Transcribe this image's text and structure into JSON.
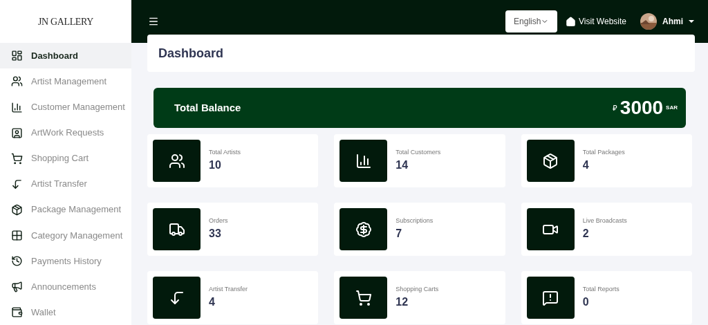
{
  "logo": "JN GALLERY",
  "sidebar": {
    "items": [
      {
        "label": "Dashboard",
        "selected": true
      },
      {
        "label": "Artist Management",
        "selected": false
      },
      {
        "label": "Customer Management",
        "selected": false
      },
      {
        "label": "ArtWork Requests",
        "selected": false
      },
      {
        "label": "Shopping Cart",
        "selected": false
      },
      {
        "label": "Artist Transfer",
        "selected": false
      },
      {
        "label": "Package Management",
        "selected": false
      },
      {
        "label": "Category Management",
        "selected": false
      },
      {
        "label": "Payments History",
        "selected": false
      },
      {
        "label": "Announcements",
        "selected": false
      },
      {
        "label": "Wallet",
        "selected": false
      }
    ]
  },
  "topbar": {
    "language": "English",
    "visit": "Visit Website",
    "user": "Ahmi"
  },
  "page_title": "Dashboard",
  "balance": {
    "label": "Total Balance",
    "currency_sign": "⃁",
    "amount": "3000",
    "unit": "SAR"
  },
  "stats": [
    {
      "label": "Total Artists",
      "value": "10"
    },
    {
      "label": "Total Customers",
      "value": "14"
    },
    {
      "label": "Total Packages",
      "value": "4"
    },
    {
      "label": "Orders",
      "value": "33"
    },
    {
      "label": "Subscriptions",
      "value": "7"
    },
    {
      "label": "Live Broadcasts",
      "value": "2"
    },
    {
      "label": "Artist Transfer",
      "value": "4"
    },
    {
      "label": "Shopping Carts",
      "value": "12"
    },
    {
      "label": "Total Reports",
      "value": "0"
    }
  ]
}
